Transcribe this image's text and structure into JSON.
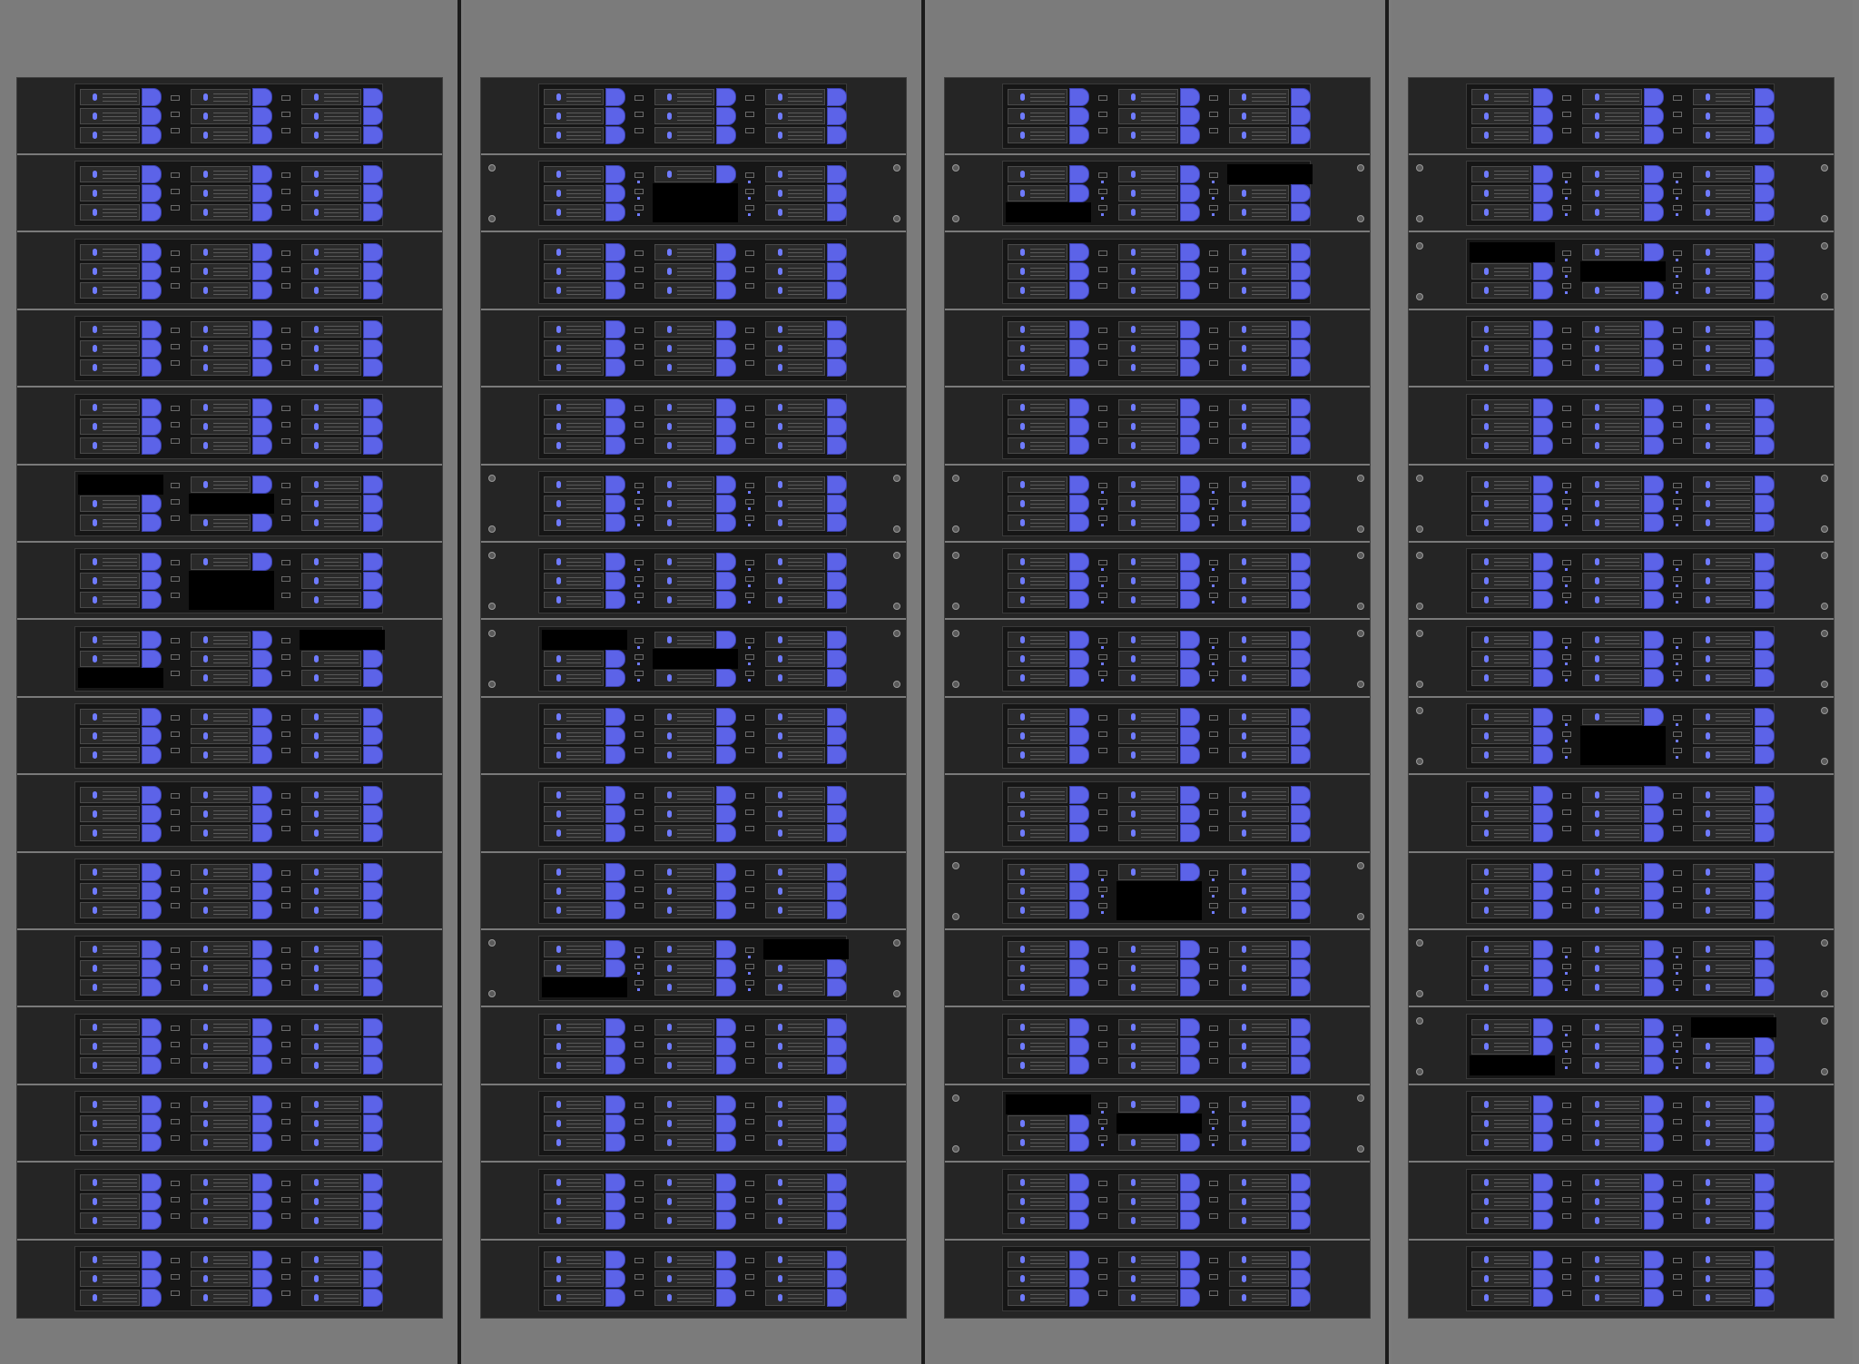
{
  "scene": {
    "description_hidden": "",
    "rack_count": 4,
    "units_per_rack": 16,
    "colors": {
      "background": "#7d7d7d",
      "rack_frame": "#7b7b7b",
      "rack_separator": "#1b1b1b",
      "rack_interior": "#262626",
      "unit_divider": "#7a7a7a",
      "chassis": "#161616",
      "drive_bay": "#2a2a2a",
      "drive_handle": "#5c63e8",
      "status_led": "#6f7bff",
      "missing_drive": "#000000"
    },
    "icons": {
      "drive_handle": "drive-handle-icon",
      "status_led": "status-led-icon",
      "rack_screw": "screw-icon"
    }
  },
  "racks": [
    {
      "missing_drive_slots": [
        {
          "unit": 5,
          "module": 0,
          "slot": 0
        },
        {
          "unit": 5,
          "module": 1,
          "slot": 1
        },
        {
          "unit": 6,
          "module": 1,
          "slot": 1
        },
        {
          "unit": 6,
          "module": 1,
          "slot": 2
        },
        {
          "unit": 7,
          "module": 0,
          "slot": 2
        },
        {
          "unit": 7,
          "module": 2,
          "slot": 0
        }
      ],
      "screw_units": []
    },
    {
      "missing_drive_slots": [
        {
          "unit": 1,
          "module": 1,
          "slot": 1
        },
        {
          "unit": 1,
          "module": 1,
          "slot": 2
        },
        {
          "unit": 7,
          "module": 0,
          "slot": 0
        },
        {
          "unit": 7,
          "module": 1,
          "slot": 1
        },
        {
          "unit": 11,
          "module": 0,
          "slot": 2
        },
        {
          "unit": 11,
          "module": 2,
          "slot": 0
        }
      ],
      "screw_units": [
        1,
        5,
        6,
        7,
        11
      ]
    },
    {
      "missing_drive_slots": [
        {
          "unit": 1,
          "module": 0,
          "slot": 2
        },
        {
          "unit": 1,
          "module": 2,
          "slot": 0
        },
        {
          "unit": 10,
          "module": 1,
          "slot": 1
        },
        {
          "unit": 10,
          "module": 1,
          "slot": 2
        },
        {
          "unit": 13,
          "module": 0,
          "slot": 0
        },
        {
          "unit": 13,
          "module": 1,
          "slot": 1
        }
      ],
      "screw_units": [
        1,
        5,
        6,
        7,
        10,
        13
      ]
    },
    {
      "missing_drive_slots": [
        {
          "unit": 2,
          "module": 0,
          "slot": 0
        },
        {
          "unit": 2,
          "module": 1,
          "slot": 1
        },
        {
          "unit": 8,
          "module": 1,
          "slot": 1
        },
        {
          "unit": 8,
          "module": 1,
          "slot": 2
        },
        {
          "unit": 12,
          "module": 0,
          "slot": 2
        },
        {
          "unit": 12,
          "module": 2,
          "slot": 0
        }
      ],
      "screw_units": [
        1,
        2,
        5,
        6,
        7,
        8,
        11,
        12
      ]
    }
  ]
}
